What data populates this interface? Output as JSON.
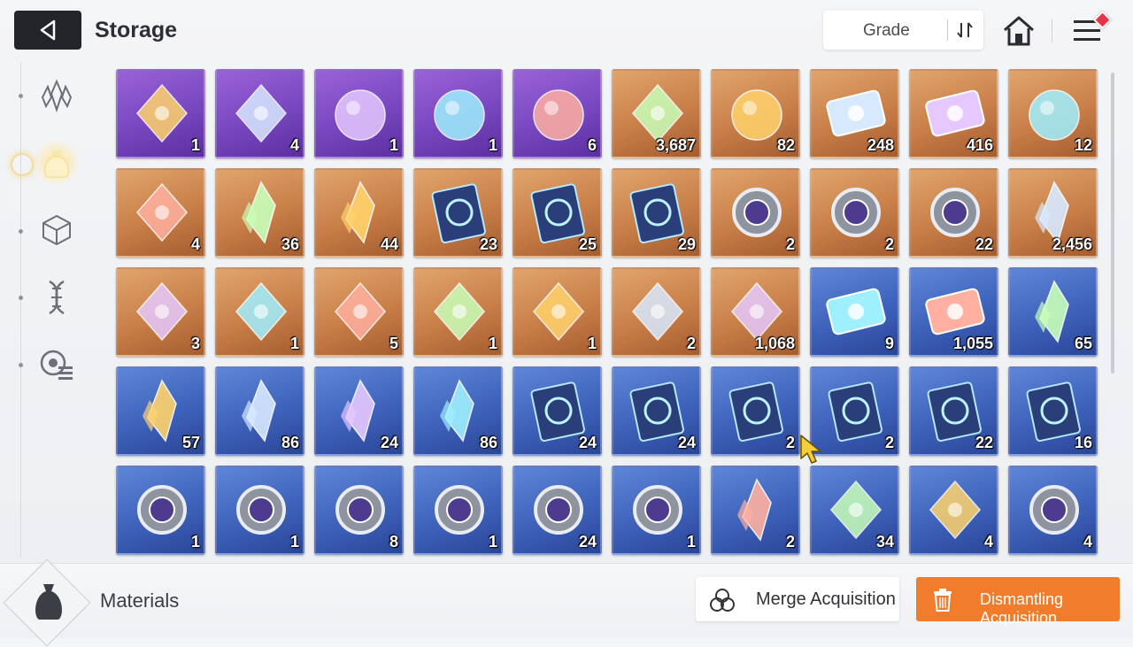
{
  "header": {
    "title": "Storage",
    "sort_label": "Grade",
    "icons": {
      "back": "back-arrow-icon",
      "sort": "sort-toggle-icon",
      "home": "home-icon",
      "menu": "menu-icon"
    }
  },
  "sidebar": {
    "items": [
      {
        "name": "crystal-category",
        "icon": "crystal-icon",
        "active": false
      },
      {
        "name": "materials-category",
        "icon": "pouch-icon",
        "active": true
      },
      {
        "name": "box-category",
        "icon": "cube-icon",
        "active": false
      },
      {
        "name": "gene-category",
        "icon": "dna-icon",
        "active": false
      },
      {
        "name": "special-category",
        "icon": "badge-list-icon",
        "active": false
      }
    ]
  },
  "colors": {
    "purple": "#7b49c2",
    "orange": "#c97e48",
    "blue": "#3e62bb",
    "accent": "#f07c2c"
  },
  "items": [
    {
      "grade": "purple",
      "icon": "dual-eye-card",
      "qty": "1"
    },
    {
      "grade": "purple",
      "icon": "winged-document",
      "qty": "4"
    },
    {
      "grade": "purple",
      "icon": "silver-core",
      "qty": "1"
    },
    {
      "grade": "purple",
      "icon": "stone-face-core",
      "qty": "1"
    },
    {
      "grade": "purple",
      "icon": "dark-skull-core",
      "qty": "6"
    },
    {
      "grade": "orange",
      "icon": "blue-eye-creature",
      "qty": "3,687"
    },
    {
      "grade": "orange",
      "icon": "cyan-orb-capsule",
      "qty": "82"
    },
    {
      "grade": "orange",
      "icon": "gold-profile-ticket",
      "qty": "248"
    },
    {
      "grade": "orange",
      "icon": "gold-star-ticket",
      "qty": "416"
    },
    {
      "grade": "orange",
      "icon": "purple-eye-rock",
      "qty": "12"
    },
    {
      "grade": "orange",
      "icon": "golden-moon-feather",
      "qty": "4"
    },
    {
      "grade": "orange",
      "icon": "purple-crystal",
      "qty": "36"
    },
    {
      "grade": "orange",
      "icon": "blue-crystal",
      "qty": "44"
    },
    {
      "grade": "orange",
      "icon": "sword-manual",
      "qty": "23"
    },
    {
      "grade": "orange",
      "icon": "shield-manual",
      "qty": "25"
    },
    {
      "grade": "orange",
      "icon": "lightning-manual",
      "qty": "29"
    },
    {
      "grade": "orange",
      "icon": "sword-medal",
      "qty": "2"
    },
    {
      "grade": "orange",
      "icon": "shield-medal",
      "qty": "2"
    },
    {
      "grade": "orange",
      "icon": "lightning-medal",
      "qty": "22"
    },
    {
      "grade": "orange",
      "icon": "yellow-shards",
      "qty": "2,456"
    },
    {
      "grade": "orange",
      "icon": "dark-prism-cube",
      "qty": "3"
    },
    {
      "grade": "orange",
      "icon": "white-sneakers",
      "qty": "1"
    },
    {
      "grade": "orange",
      "icon": "star-map-book",
      "qty": "5"
    },
    {
      "grade": "orange",
      "icon": "spray-gun",
      "qty": "1"
    },
    {
      "grade": "orange",
      "icon": "dreamcatcher",
      "qty": "1"
    },
    {
      "grade": "orange",
      "icon": "guitar-pick",
      "qty": "2"
    },
    {
      "grade": "orange",
      "icon": "music-note-scroll",
      "qty": "1,068"
    },
    {
      "grade": "blue",
      "icon": "blue-profile-ticket",
      "qty": "9"
    },
    {
      "grade": "blue",
      "icon": "blue-star-ticket",
      "qty": "1,055"
    },
    {
      "grade": "blue",
      "icon": "red-crystal",
      "qty": "65"
    },
    {
      "grade": "blue",
      "icon": "fire-crystal",
      "qty": "57"
    },
    {
      "grade": "blue",
      "icon": "violet-crystal",
      "qty": "86"
    },
    {
      "grade": "blue",
      "icon": "green-crystal",
      "qty": "24"
    },
    {
      "grade": "blue",
      "icon": "ice-crystal",
      "qty": "86"
    },
    {
      "grade": "blue",
      "icon": "sword-manual",
      "qty": "24"
    },
    {
      "grade": "blue",
      "icon": "shield-manual",
      "qty": "24"
    },
    {
      "grade": "blue",
      "icon": "eye-manual",
      "qty": "2"
    },
    {
      "grade": "blue",
      "icon": "wing-manual",
      "qty": "2"
    },
    {
      "grade": "blue",
      "icon": "lightning-manual",
      "qty": "22"
    },
    {
      "grade": "blue",
      "icon": "target-manual",
      "qty": "16"
    },
    {
      "grade": "blue",
      "icon": "sword-medal",
      "qty": "1"
    },
    {
      "grade": "blue",
      "icon": "shield-medal",
      "qty": "1"
    },
    {
      "grade": "blue",
      "icon": "eye-medal",
      "qty": "8"
    },
    {
      "grade": "blue",
      "icon": "wing-medal",
      "qty": "1"
    },
    {
      "grade": "blue",
      "icon": "lightning-medal",
      "qty": "24"
    },
    {
      "grade": "blue",
      "icon": "target-medal",
      "qty": "1"
    },
    {
      "grade": "blue",
      "icon": "blue-shard-gem",
      "qty": "2"
    },
    {
      "grade": "blue",
      "icon": "strawberry-cake",
      "qty": "34"
    },
    {
      "grade": "blue",
      "icon": "pocket-watch",
      "qty": "4"
    },
    {
      "grade": "blue",
      "icon": "red-star-medal",
      "qty": "4"
    }
  ],
  "footer": {
    "category_label": "Materials",
    "category_icon": "pouch-icon",
    "merge_label": "Merge Acquisition",
    "dismantle_label": "Dismantling Acquisition"
  }
}
